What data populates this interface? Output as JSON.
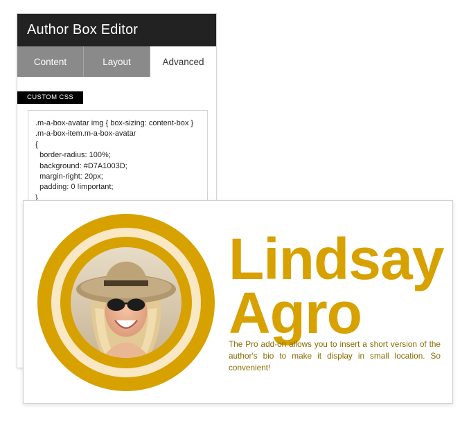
{
  "editor": {
    "title": "Author Box Editor",
    "tabs": [
      {
        "label": "Content",
        "active": false
      },
      {
        "label": "Layout",
        "active": false
      },
      {
        "label": "Advanced",
        "active": true
      }
    ],
    "section_label": "CUSTOM CSS",
    "custom_css": ".m-a-box-avatar img { box-sizing: content-box }\n.m-a-box-item.m-a-box-avatar\n{\n  border-radius: 100%;\n  background: #D7A1003D;\n  margin-right: 20px;\n  padding: 0 !important;\n}"
  },
  "author_box": {
    "first_name": "Lindsay",
    "last_name": "Agro",
    "bio": "The Pro add-on allows you to insert a short version of the author's bio to make it display in small location. So convenient!",
    "accent_color": "#D7A100",
    "ring_light_color": "#FAE8C4",
    "bio_color": "#8a6a00"
  }
}
